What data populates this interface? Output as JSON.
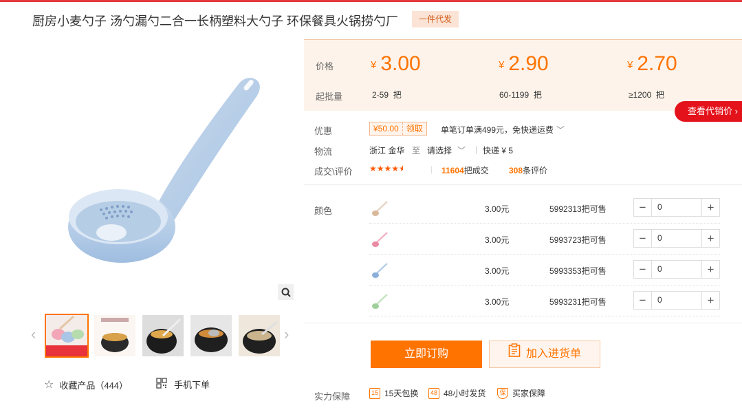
{
  "product": {
    "title": "厨房小麦勺子 汤勺漏勺二合一长柄塑料大勺子 环保餐具火锅捞勺厂",
    "badge": "一件代发"
  },
  "price_box": {
    "price_label": "价格",
    "moq_label": "起批量",
    "currency": "¥",
    "tiers": [
      {
        "price": "3.00",
        "qty": "2-59",
        "unit": "把"
      },
      {
        "price": "2.90",
        "qty": "60-1199",
        "unit": "把"
      },
      {
        "price": "2.70",
        "qty": "≥1200",
        "unit": "把"
      }
    ],
    "agent_price_button": "查看代销价 ›"
  },
  "promo": {
    "label": "优惠",
    "coupon_amount": "¥50.00",
    "coupon_get": "领取",
    "text": "单笔订单满499元，免快递运费"
  },
  "logistics": {
    "label": "物流",
    "origin": "浙江 金华",
    "to": "至",
    "dest": "请选择",
    "express": "快递 ¥ 5"
  },
  "deals": {
    "label": "成交\\评价",
    "rating": 4.5,
    "count": "11604",
    "count_suffix": "把成交",
    "reviews": "308",
    "reviews_suffix": "条评价"
  },
  "sku": {
    "label": "颜色",
    "rows": [
      {
        "price": "3.00元",
        "stock": "5992313",
        "stock_suffix": "把可售",
        "qty": "0",
        "color": "#d9b89a"
      },
      {
        "price": "3.00元",
        "stock": "5993723",
        "stock_suffix": "把可售",
        "qty": "0",
        "color": "#e98aa3"
      },
      {
        "price": "3.00元",
        "stock": "5993353",
        "stock_suffix": "把可售",
        "qty": "0",
        "color": "#8ab0d9"
      },
      {
        "price": "3.00元",
        "stock": "5993231",
        "stock_suffix": "把可售",
        "qty": "0",
        "color": "#9fcf9a"
      }
    ]
  },
  "actions": {
    "buy": "立即订购",
    "cart": "加入进货单"
  },
  "gallery": {
    "favorite": "收藏产品（444）",
    "mobile": "手机下单"
  },
  "guarantee": {
    "label": "实力保障",
    "items": [
      {
        "icon_text": "15",
        "label": "15天包换"
      },
      {
        "icon_text": "48",
        "label": "48小时发货"
      },
      {
        "icon_text": "保",
        "label": "买家保障"
      }
    ]
  },
  "colors": {
    "accent": "#ff7300",
    "red": "#e4131b",
    "price_bg": "#fdf3ea"
  }
}
